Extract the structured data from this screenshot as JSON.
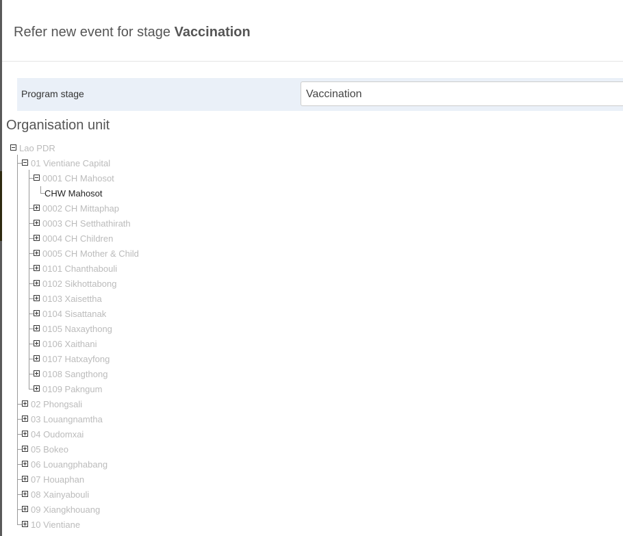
{
  "modal": {
    "title_prefix": "Refer new event for stage",
    "title_stage": "Vaccination"
  },
  "program_stage": {
    "label": "Program stage",
    "selected": "Vaccination"
  },
  "org_unit": {
    "title": "Organisation unit",
    "root": {
      "label": "Lao PDR",
      "expanded": true
    },
    "level1": [
      {
        "label": "01 Vientiane Capital",
        "expanded": true
      },
      {
        "label": "02 Phongsali",
        "expanded": false
      },
      {
        "label": "03 Louangnamtha",
        "expanded": false
      },
      {
        "label": "04 Oudomxai",
        "expanded": false
      },
      {
        "label": "05 Bokeo",
        "expanded": false
      },
      {
        "label": "06 Louangphabang",
        "expanded": false
      },
      {
        "label": "07 Houaphan",
        "expanded": false
      },
      {
        "label": "08 Xainyabouli",
        "expanded": false
      },
      {
        "label": "09 Xiangkhouang",
        "expanded": false
      },
      {
        "label": "10 Vientiane",
        "expanded": false
      }
    ],
    "level2": [
      {
        "label": "0001 CH Mahosot",
        "expanded": true
      },
      {
        "label": "0002 CH Mittaphap",
        "expanded": false
      },
      {
        "label": "0003 CH Setthathirath",
        "expanded": false
      },
      {
        "label": "0004 CH Children",
        "expanded": false
      },
      {
        "label": "0005 CH Mother & Child",
        "expanded": false
      },
      {
        "label": "0101 Chanthabouli",
        "expanded": false
      },
      {
        "label": "0102 Sikhottabong",
        "expanded": false
      },
      {
        "label": "0103 Xaisettha",
        "expanded": false
      },
      {
        "label": "0104 Sisattanak",
        "expanded": false
      },
      {
        "label": "0105 Naxaythong",
        "expanded": false
      },
      {
        "label": "0106 Xaithani",
        "expanded": false
      },
      {
        "label": "0107 Hatxayfong",
        "expanded": false
      },
      {
        "label": "0108 Sangthong",
        "expanded": false
      },
      {
        "label": "0109 Pakngum",
        "expanded": false
      }
    ],
    "level3": [
      {
        "label": "CHW Mahosot",
        "selectable": true
      }
    ]
  }
}
